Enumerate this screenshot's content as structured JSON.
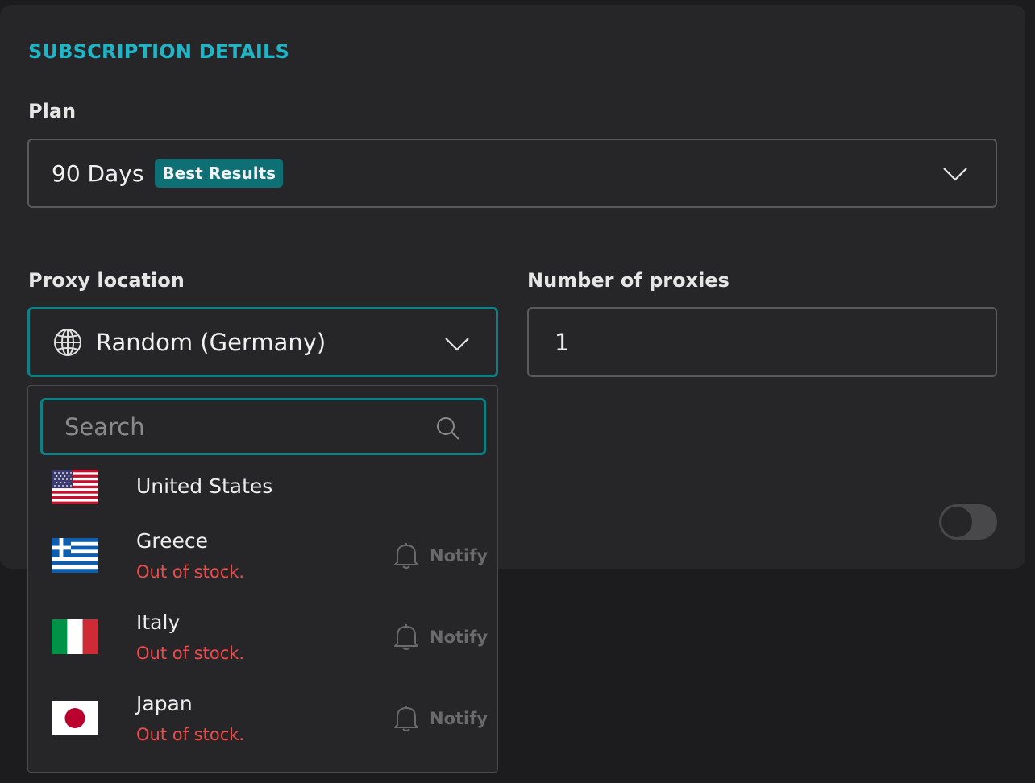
{
  "colors": {
    "accent": "#1fb5c6",
    "badge_bg": "#0e6f75",
    "focus_border": "#0e7f82",
    "error": "#f04a4a"
  },
  "section": {
    "title": "SUBSCRIPTION DETAILS"
  },
  "plan": {
    "label": "Plan",
    "selected": "90 Days",
    "badge": "Best Results",
    "icon": "chevron-down-icon"
  },
  "location": {
    "label": "Proxy location",
    "selected": "Random (Germany)",
    "icon": "globe-icon",
    "search_placeholder": "Search",
    "options": [
      {
        "name": "United States",
        "flag": "us-flag-icon",
        "status": "",
        "action": ""
      },
      {
        "name": "Greece",
        "flag": "greece-flag-icon",
        "status": "Out of stock.",
        "action": "Notify"
      },
      {
        "name": "Italy",
        "flag": "italy-flag-icon",
        "status": "Out of stock.",
        "action": "Notify"
      },
      {
        "name": "Japan",
        "flag": "japan-flag-icon",
        "status": "Out of stock.",
        "action": "Notify"
      }
    ]
  },
  "proxies": {
    "label": "Number of proxies",
    "value": "1"
  },
  "toggle": {
    "on": false
  }
}
